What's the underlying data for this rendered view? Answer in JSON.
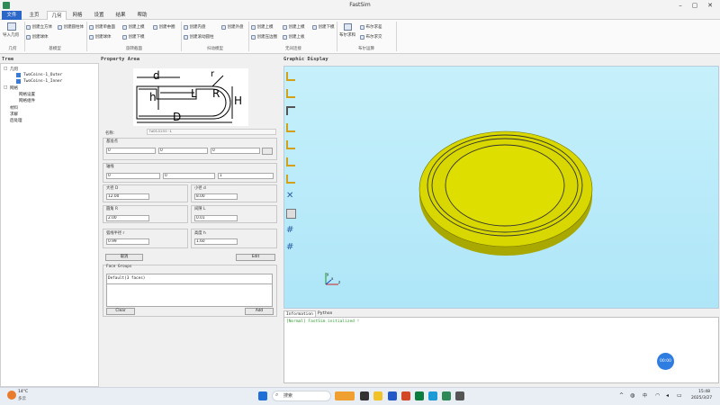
{
  "app": {
    "title": "FastSim"
  },
  "menu": {
    "tabs": [
      "文件",
      "主页",
      "几何",
      "网格",
      "设置",
      "结果",
      "帮助"
    ],
    "active": "几何"
  },
  "ribbon": {
    "import": "导入几何",
    "groups": {
      "import": "几何",
      "basic": "基模型",
      "rotate": "旋转截面",
      "sweep": "扫动模型",
      "nonunif": "无间连接",
      "bool": "布尔运算"
    },
    "items": {
      "cube": "创建立方体",
      "sphere": "创建球体",
      "cylinder": "创建圆柱体",
      "single_arc": "创建单曲面",
      "rot_up": "创建上模",
      "rot_down": "创建下模",
      "mid_plane": "创建中圈",
      "pan": "创建内盘",
      "sweep_cyl": "创建滚动圆柱",
      "outer_pan": "创建外盘",
      "up_mold": "创建上模",
      "down_mold": "创建下模",
      "roll_circle": "创建压边圈",
      "upper_die": "创建上模",
      "lower_die": "创建下模",
      "upper_plate": "创建上板",
      "bool_sum": "布尔求和",
      "bool_diff": "布尔求差",
      "bool_intersect": "布尔求交"
    }
  },
  "tree": {
    "header": "Tree",
    "nodes": [
      "几何",
      "TwoCoins-1_Outer",
      "TwoCoins-1_Inner",
      "网格",
      "网格设置",
      "网格组件",
      "材料",
      "求解",
      "后处理"
    ],
    "expanders": [
      "□",
      "□"
    ]
  },
  "property": {
    "header": "Property Area",
    "diagram": {
      "d": "d",
      "r": "r",
      "h": "h",
      "L": "L",
      "R": "R",
      "H": "H",
      "D": "D"
    },
    "name_label": "名称:",
    "name_value": "TwoCoins-1",
    "base_label": "基准点",
    "base": [
      "0",
      "0",
      "0"
    ],
    "axis_label": "轴线",
    "axis": [
      "0",
      "0",
      "1"
    ],
    "big_d_label": "大径 D",
    "big_d": "12.00",
    "small_d_label": "小径 d",
    "small_d": "8.00",
    "fillet_label": "圆角 R",
    "fillet": "2.00",
    "gap_label": "间隙 L",
    "gap": "0.01",
    "arc_label": "弧线半径 r",
    "arc": "0.99",
    "height_label": "高度 h",
    "height": "1.60",
    "cancel": "取消",
    "edit": "Edit",
    "face_groups": "Face Groups",
    "face_item": "Default(3 faces)",
    "clear": "Clear",
    "add": "Add"
  },
  "graphic": {
    "header": "Graphic Display",
    "disk_color": "#d8d800",
    "bg_color": "#b8ecf9",
    "axes": {
      "x": "x",
      "y": "y",
      "z": "z"
    }
  },
  "info": {
    "tabs": [
      "Information",
      "Python"
    ],
    "message": "[Normal] FastSim initialized !",
    "fab_label": "00:00"
  },
  "taskbar": {
    "weather_temp": "14°C",
    "weather_text": "多云",
    "search": "搜索",
    "time": "15:48",
    "date": "2025/3/27",
    "tray_lang": "中"
  }
}
